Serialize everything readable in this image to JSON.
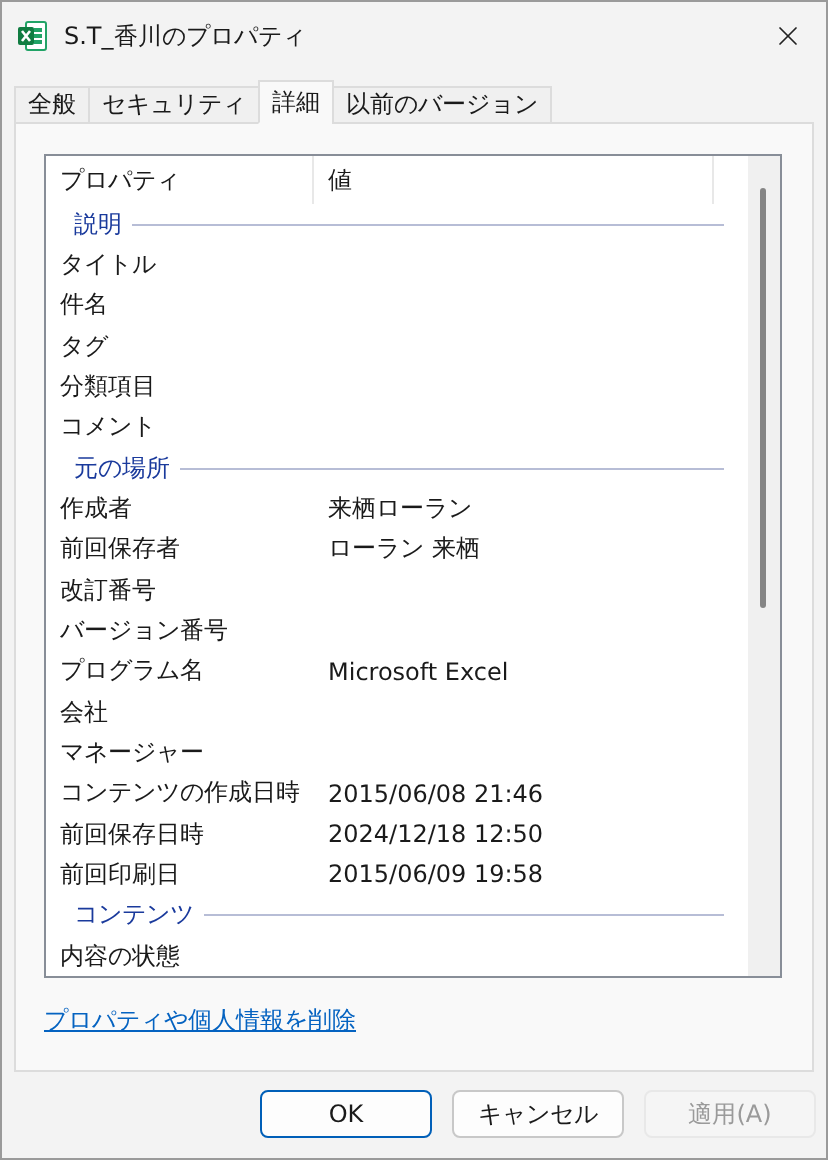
{
  "window": {
    "title": "S.T_香川のプロパティ"
  },
  "tabs": [
    {
      "label": "全般",
      "selected": false
    },
    {
      "label": "セキュリティ",
      "selected": false
    },
    {
      "label": "詳細",
      "selected": true
    },
    {
      "label": "以前のバージョン",
      "selected": false
    }
  ],
  "table": {
    "columns": [
      "プロパティ",
      "値"
    ],
    "rows": [
      {
        "kind": "group",
        "name": "説明"
      },
      {
        "kind": "property",
        "name": "タイトル"
      },
      {
        "kind": "property",
        "name": "件名"
      },
      {
        "kind": "property",
        "name": "タグ"
      },
      {
        "kind": "property",
        "name": "分類項目"
      },
      {
        "kind": "property",
        "name": "コメント"
      },
      {
        "kind": "group",
        "name": "元の場所"
      },
      {
        "kind": "property",
        "name": "作成者",
        "value": "来栖ローラン"
      },
      {
        "kind": "property",
        "name": "前回保存者",
        "value": "ローラン 来栖"
      },
      {
        "kind": "property",
        "name": "改訂番号"
      },
      {
        "kind": "property",
        "name": "バージョン番号"
      },
      {
        "kind": "property",
        "name": "プログラム名",
        "value": "Microsoft Excel"
      },
      {
        "kind": "property",
        "name": "会社"
      },
      {
        "kind": "property",
        "name": "マネージャー"
      },
      {
        "kind": "property",
        "name": "コンテンツの作成日時",
        "value": "2015/06/08 21:46"
      },
      {
        "kind": "property",
        "name": "前回保存日時",
        "value": "2024/12/18 12:50"
      },
      {
        "kind": "property",
        "name": "前回印刷日",
        "value": "2015/06/09 19:58"
      },
      {
        "kind": "group",
        "name": "コンテンツ"
      },
      {
        "kind": "property",
        "name": "内容の状態"
      }
    ]
  },
  "link": "プロパティや個人情報を削除",
  "buttons": [
    {
      "label": "OK",
      "default": true,
      "disabled": false
    },
    {
      "label": "キャンセル",
      "default": false,
      "disabled": false
    },
    {
      "label": "適用(A)",
      "default": false,
      "disabled": true
    }
  ]
}
